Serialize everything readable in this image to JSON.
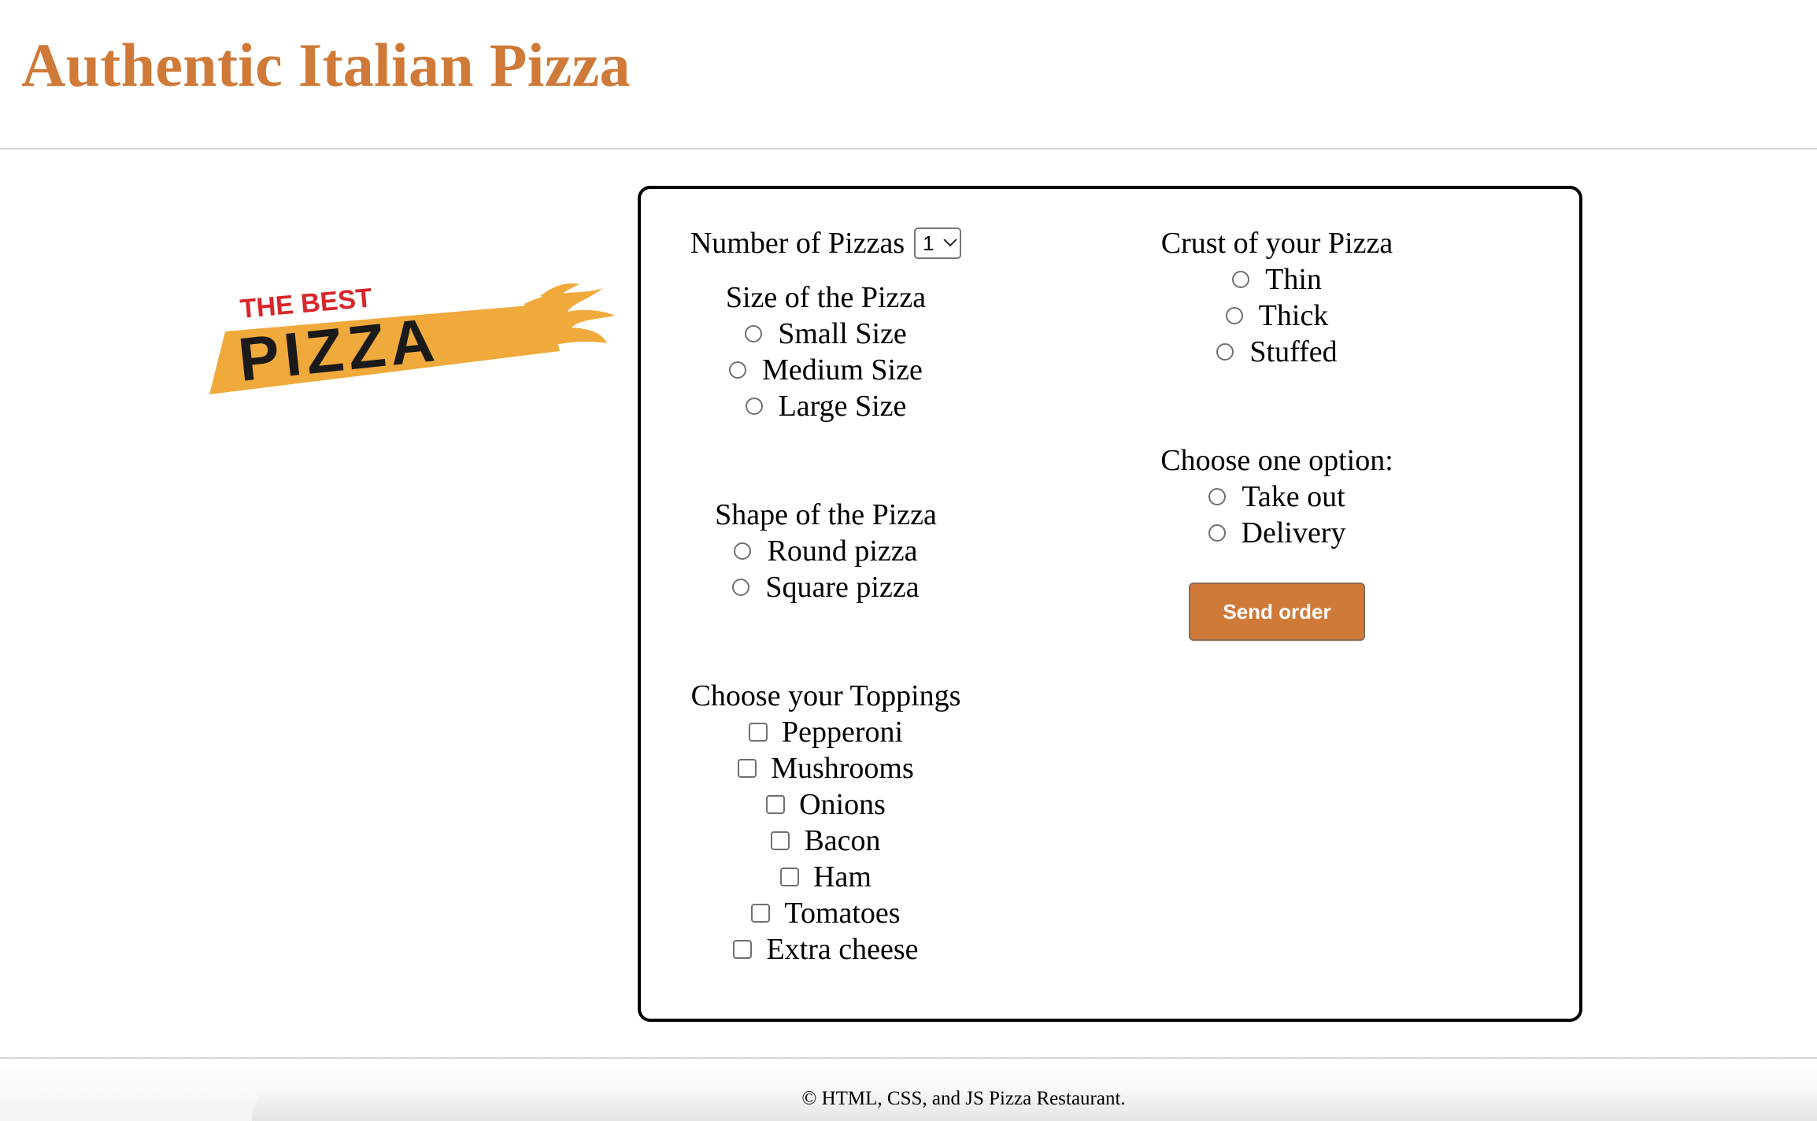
{
  "header": {
    "title": "Authentic Italian Pizza"
  },
  "logo": {
    "line1": "THE BEST",
    "line2": "PIZZA"
  },
  "order_form": {
    "number_of_pizzas": {
      "label": "Number of Pizzas",
      "selected": "1"
    },
    "size": {
      "label": "Size of the Pizza",
      "options": [
        "Small Size",
        "Medium Size",
        "Large Size"
      ]
    },
    "shape": {
      "label": "Shape of the Pizza",
      "options": [
        "Round pizza",
        "Square pizza"
      ]
    },
    "toppings": {
      "label": "Choose your Toppings",
      "options": [
        "Pepperoni",
        "Mushrooms",
        "Onions",
        "Bacon",
        "Ham",
        "Tomatoes",
        "Extra cheese"
      ]
    },
    "crust": {
      "label": "Crust of your Pizza",
      "options": [
        "Thin",
        "Thick",
        "Stuffed"
      ]
    },
    "service": {
      "label": "Choose one option:",
      "options": [
        "Take out",
        "Delivery"
      ]
    },
    "submit_label": "Send order"
  },
  "footer": {
    "text": "© HTML, CSS, and JS Pizza Restaurant."
  },
  "colors": {
    "accent": "#cf7a38",
    "logo_banner": "#f0a93b",
    "logo_red": "#d8262a"
  }
}
